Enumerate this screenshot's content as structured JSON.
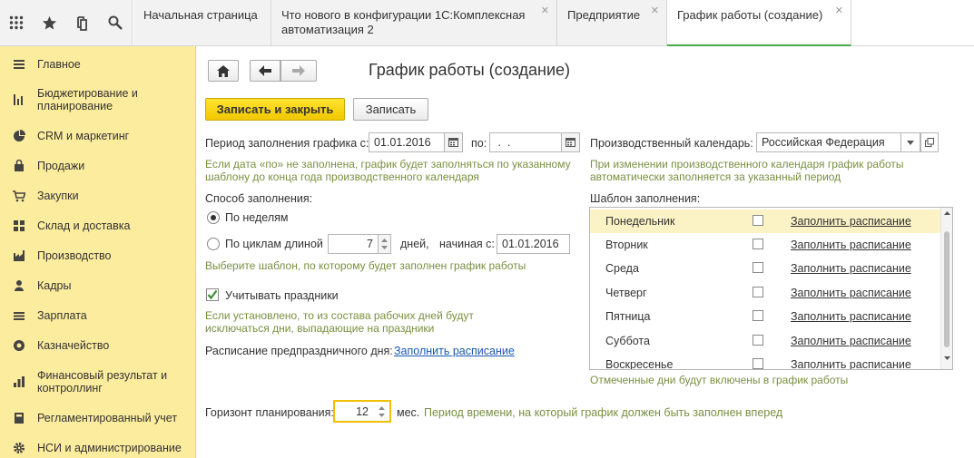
{
  "topbar": {
    "icons": [
      "apps-grid-icon",
      "star-icon",
      "history-icon",
      "search-icon"
    ],
    "tabs": [
      {
        "label": "Начальная страница",
        "closable": false
      },
      {
        "label": "Что нового в конфигурации 1С:Комплексная автоматизация 2",
        "closable": true
      },
      {
        "label": "Предприятие",
        "closable": true
      },
      {
        "label": "График работы (создание)",
        "closable": true,
        "active": true
      }
    ]
  },
  "sidebar": {
    "items": [
      {
        "label": "Главное",
        "icon": "menu-icon"
      },
      {
        "label": "Бюджетирование и планирование",
        "icon": "budget-icon"
      },
      {
        "label": "CRM и маркетинг",
        "icon": "pie-chart-icon"
      },
      {
        "label": "Продажи",
        "icon": "bag-icon"
      },
      {
        "label": "Закупки",
        "icon": "cart-icon"
      },
      {
        "label": "Склад и доставка",
        "icon": "warehouse-icon"
      },
      {
        "label": "Производство",
        "icon": "factory-icon"
      },
      {
        "label": "Кадры",
        "icon": "person-icon"
      },
      {
        "label": "Зарплата",
        "icon": "money-icon"
      },
      {
        "label": "Казначейство",
        "icon": "coin-icon"
      },
      {
        "label": "Финансовый результат и контроллинг",
        "icon": "bar-chart-icon"
      },
      {
        "label": "Регламентированный учет",
        "icon": "calculator-icon"
      },
      {
        "label": "НСИ и администрирование",
        "icon": "gear-icon"
      }
    ]
  },
  "form": {
    "title": "График работы (создание)",
    "save_close_label": "Записать и закрыть",
    "save_label": "Записать",
    "period_label": "Период заполнения графика с:",
    "period_from": "01.01.2016",
    "period_to_label": "по:",
    "period_to": " .  .",
    "period_hint": "Если дата «по» не заполнена, график будет заполняться по указанному шаблону до конца года производственного календаря",
    "method_label": "Способ заполнения:",
    "by_weeks_label": "По неделям",
    "by_cycles_label": "По циклам длиной",
    "cycle_length": "7",
    "days_label": "дней,",
    "starting_label": "начиная с:",
    "starting_date": "01.01.2016",
    "method_hint": "Выберите шаблон, по которому будет заполнен график работы",
    "holidays_label": "Учитывать праздники",
    "holidays_hint": "Если установлено, то из состава рабочих дней будут исключаться дни, выпадающие на праздники",
    "preholiday_label": "Расписание предпраздничного дня:",
    "preholiday_link": "Заполнить расписание",
    "horizon_label": "Горизонт планирования:",
    "horizon_value": "12",
    "horizon_unit": "мес.",
    "horizon_hint": "Период времени, на который график должен быть заполнен вперед",
    "calendar_label": "Производственный календарь:",
    "calendar_value": "Российская Федерация",
    "calendar_hint": "При изменении производственного календаря график работы автоматически заполняется за указанный период",
    "template_label": "Шаблон заполнения:",
    "template_hint": "Отмеченные дни будут включены в график работы",
    "fill_link": "Заполнить расписание",
    "weekdays": [
      "Понедельник",
      "Вторник",
      "Среда",
      "Четверг",
      "Пятница",
      "Суббота",
      "Воскресенье"
    ]
  },
  "colors": {
    "sidebar": "#fcec9e",
    "primary_button": "#f5d21c",
    "hint": "#7a8f41",
    "link": "#1a58b0",
    "active_tab": "#4aa64a"
  }
}
